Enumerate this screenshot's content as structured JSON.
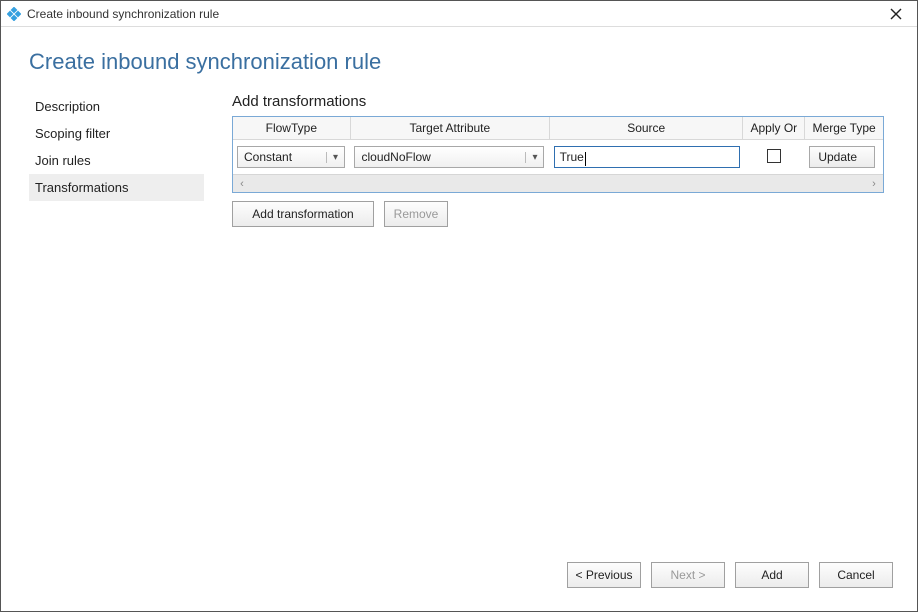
{
  "window": {
    "title": "Create inbound synchronization rule"
  },
  "page": {
    "heading": "Create inbound synchronization rule"
  },
  "nav": {
    "items": [
      {
        "label": "Description",
        "selected": false
      },
      {
        "label": "Scoping filter",
        "selected": false
      },
      {
        "label": "Join rules",
        "selected": false
      },
      {
        "label": "Transformations",
        "selected": true
      }
    ]
  },
  "section": {
    "title": "Add transformations"
  },
  "grid": {
    "headers": {
      "flowtype": "FlowType",
      "target": "Target Attribute",
      "source": "Source",
      "apply": "Apply Or",
      "merge": "Merge Type"
    },
    "row": {
      "flowtype": "Constant",
      "target": "cloudNoFlow",
      "source": "True",
      "apply_checked": false,
      "merge": "Update"
    }
  },
  "buttons": {
    "add_transformation": "Add transformation",
    "remove": "Remove",
    "previous": "< Previous",
    "next": "Next >",
    "add": "Add",
    "cancel": "Cancel"
  }
}
